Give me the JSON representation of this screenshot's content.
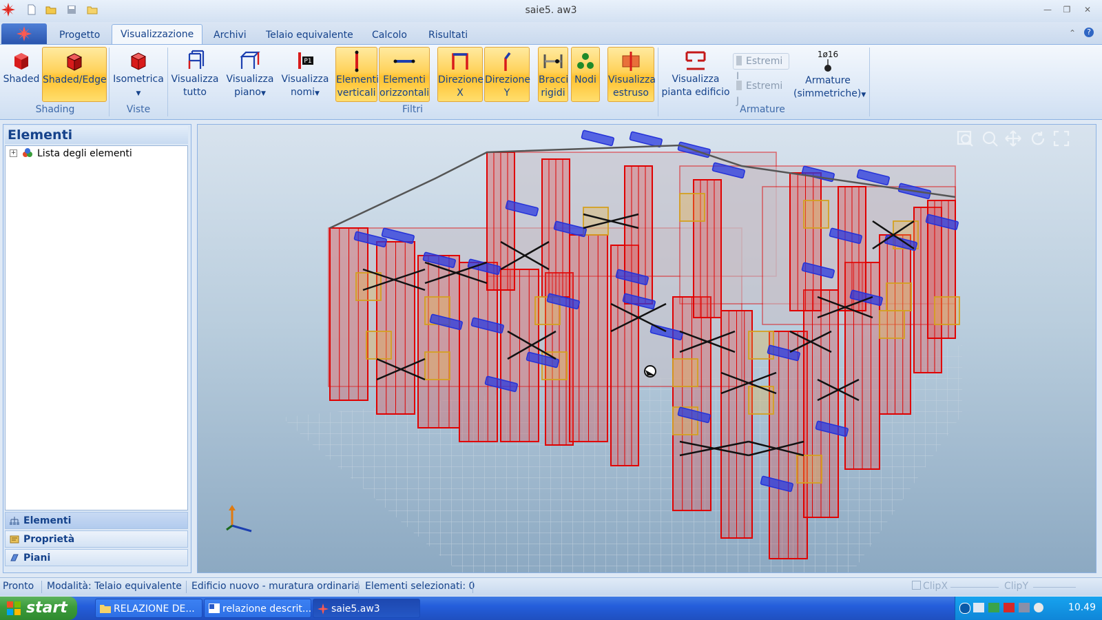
{
  "window": {
    "title": "saie5. aw3"
  },
  "tabs": [
    "Progetto",
    "Visualizzazione",
    "Archivi",
    "Telaio equivalente",
    "Calcolo",
    "Risultati"
  ],
  "active_tab": "Visualizzazione",
  "ribbon": {
    "shading": {
      "label": "Shading",
      "shaded": "Shaded",
      "shaded_edge": "Shaded/Edge"
    },
    "viste": {
      "label": "Viste",
      "isometrica": "Isometrica"
    },
    "filtri": {
      "label": "Filtri",
      "visualizza_tutto": [
        "Visualizza",
        "tutto"
      ],
      "visualizza_piano": [
        "Visualizza",
        "piano"
      ],
      "visualizza_nomi": [
        "Visualizza",
        "nomi"
      ],
      "nomi_badge": "P1",
      "elementi_verticali": [
        "Elementi",
        "verticali"
      ],
      "elementi_orizzontali": [
        "Elementi",
        "orizzontali"
      ],
      "direzione_x": [
        "Direzione",
        "X"
      ],
      "direzione_y": [
        "Direzione",
        "Y"
      ],
      "bracci_rigidi": [
        "Bracci",
        "rigidi"
      ],
      "nodi": "Nodi",
      "visualizza_estruso": [
        "Visualizza",
        "estruso"
      ]
    },
    "armature": {
      "label": "Armature",
      "visualizza_pianta": [
        "Visualizza",
        "pianta edificio"
      ],
      "estremi_i": "Estremi I",
      "estremi_j": "Estremi J",
      "armature_sim": [
        "Armature",
        "(simmetriche)"
      ],
      "armature_badge": "1ø16"
    }
  },
  "left_panel": {
    "title": "Elementi",
    "tree_root": "Lista degli elementi",
    "nav": [
      "Elementi",
      "Proprietà",
      "Piani"
    ]
  },
  "status": {
    "pronto": "Pronto",
    "modalita": "Modalità: Telaio equivalente",
    "edificio": "Edificio nuovo - muratura ordinaria",
    "selezionati": "Elementi selezionati: 0",
    "clipx": "ClipX",
    "clipy": "ClipY"
  },
  "taskbar": {
    "start": "start",
    "tasks": [
      "RELAZIONE DE...",
      "relazione descrit...",
      "saie5.aw3"
    ],
    "clock": "10.49"
  },
  "colors": {
    "ribbon_active": "#ffc12e",
    "wall_red": "#e00000",
    "beam_blue": "#2432d8",
    "spandrel_gold": "#d4a020"
  }
}
